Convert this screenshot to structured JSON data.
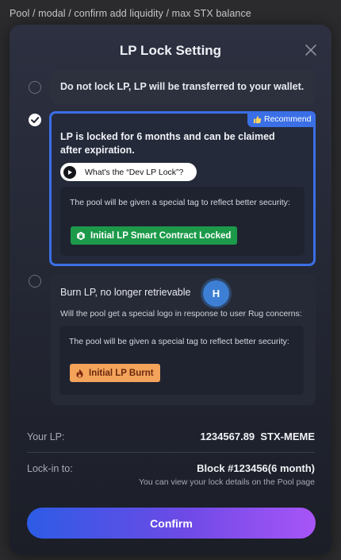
{
  "breadcrumb": "Pool / modal / confirm add liquidity / max STX balance",
  "modal": {
    "title": "LP Lock Setting",
    "options": [
      {
        "label": "Do not lock LP, LP will be transferred to your wallet.",
        "selected": false
      },
      {
        "label": "LP is locked for 6 months and can be claimed after expiration.",
        "selected": true,
        "badge": "Recommend",
        "badge_icon": "thumbs-up-icon",
        "info_button": "What's the “Dev LP Lock”?",
        "description": "The pool will be given a special tag to reflect better security:",
        "tag": "Initial LP Smart Contract Locked"
      },
      {
        "label": "Burn LP, no longer retrievable",
        "selected": false,
        "subtext": "Will the pool get a special logo in response to user Rug concerns:",
        "description": "The pool will be given a special tag to reflect better security:",
        "tag": "Initial LP Burnt"
      }
    ],
    "avatar_initial": "H",
    "your_lp": {
      "label": "Your LP:",
      "value": "1234567.89  STX-MEME"
    },
    "lock_in": {
      "label": "Lock-in to:",
      "value": "Block #123456(6 month)",
      "note": "You can view your lock details on the Pool page"
    },
    "confirm_label": "Confirm"
  },
  "colors": {
    "accent_blue": "#3a6fe6",
    "locked_green": "#1c9a4a",
    "burnt_orange": "#f4a35a",
    "confirm_gradient_start": "#2d5ce5",
    "confirm_gradient_end": "#a855f7"
  }
}
